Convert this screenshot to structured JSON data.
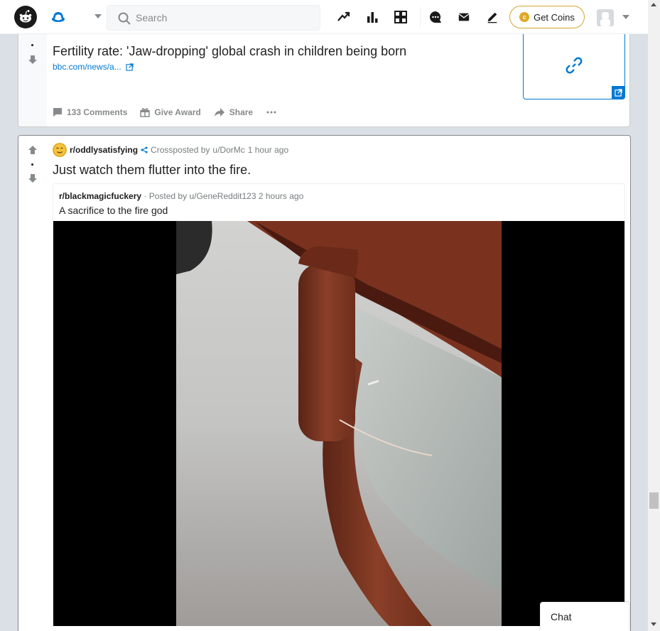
{
  "header": {
    "search_placeholder": "Search",
    "get_coins_label": "Get Coins",
    "coin_symbol": "c"
  },
  "post1": {
    "title": "Fertility rate: 'Jaw-dropping' global crash in children being born",
    "link_text": "bbc.com/news/a...",
    "comments_label": "133 Comments",
    "award_label": "Give Award",
    "share_label": "Share"
  },
  "post2": {
    "subreddit": "r/oddlysatisfying",
    "crosspost_label": "Crossposted by",
    "user": "u/DorMc",
    "time": "1 hour ago",
    "title": "Just watch them flutter into the fire.",
    "crosspost": {
      "subreddit": "r/blackmagicfuckery",
      "posted_by": "· Posted by u/GeneReddit123",
      "time": "2 hours ago",
      "title": "A sacrifice to the fire god"
    }
  },
  "chat": {
    "label": "Chat"
  },
  "colors": {
    "accent": "#0079d3",
    "coins_border": "#d4a52f",
    "background": "#dae0e6"
  },
  "icons": [
    "reddit-logo",
    "home-icon",
    "search-icon",
    "trending-icon",
    "stats-icon",
    "rpan-icon",
    "chat-icon",
    "mail-icon",
    "pencil-icon",
    "coin-icon",
    "upvote-icon",
    "downvote-icon",
    "comment-icon",
    "gift-icon",
    "share-icon",
    "more-icon",
    "link-icon",
    "external-link-icon"
  ]
}
